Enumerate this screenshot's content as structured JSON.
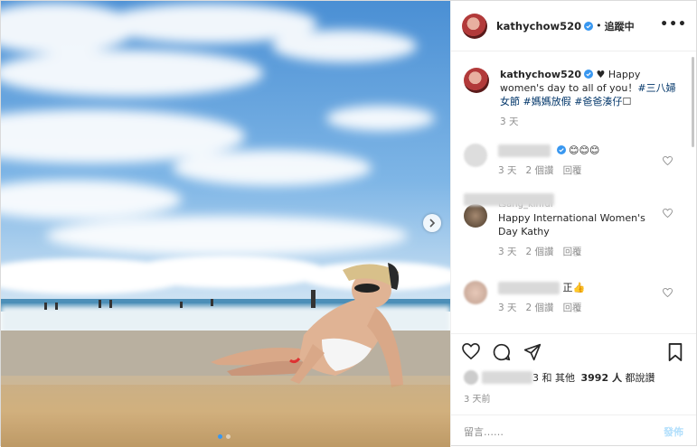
{
  "header": {
    "username": "kathychow520",
    "separator": "•",
    "follow_label": "追蹤中",
    "more_label": "•••"
  },
  "caption": {
    "username": "kathychow520",
    "text_before": " ♥ Happy women's day to all of you！",
    "hashtags": "#三八婦女節 #媽媽放假 #爸爸湊仔",
    "text_after": "☐",
    "time": "3 天"
  },
  "comments": [
    {
      "text": "😊😊😊",
      "time": "3 天",
      "likes": "2 個讚",
      "reply": "回覆"
    },
    {
      "username": "tsang_kinfui",
      "text": "Happy International Women's Day Kathy",
      "time": "3 天",
      "likes": "2 個讚",
      "reply": "回覆"
    },
    {
      "text": "正👍",
      "time": "3 天",
      "likes": "2 個讚",
      "reply": "回覆"
    }
  ],
  "likes": {
    "prefix": "3 和 其他",
    "count": "3992 人",
    "suffix": "都說讚"
  },
  "post_time": "3 天前",
  "add_comment": {
    "placeholder": "留言……",
    "post_label": "發佈"
  },
  "icons": [
    "verified-badge-icon",
    "more-icon",
    "heart-icon",
    "comment-icon",
    "share-icon",
    "bookmark-icon",
    "next-arrow-icon"
  ],
  "colors": {
    "link": "#003569",
    "verified": "#3897f0",
    "post_disabled": "#b2dffc"
  }
}
